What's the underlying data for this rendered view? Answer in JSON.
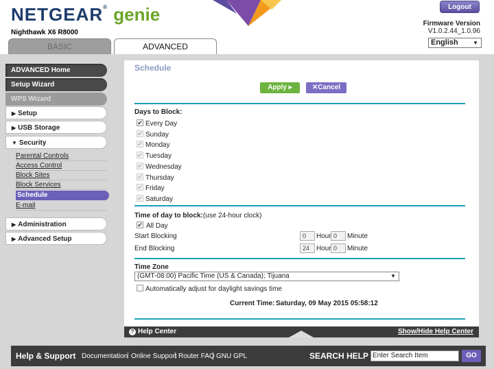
{
  "header": {
    "logo_main": "NETGEAR",
    "logo_reg": "®",
    "logo_genie": "genie",
    "model": "Nighthawk X6 R8000",
    "logout": "Logout",
    "firmware_label": "Firmware Version",
    "firmware_value": "V1.0.2.44_1.0.96",
    "language": "English"
  },
  "tabs": {
    "basic": "BASIC",
    "advanced": "ADVANCED"
  },
  "sidebar": {
    "advanced_home": "ADVANCED Home",
    "setup_wizard": "Setup Wizard",
    "wps_wizard": "WPS Wizard",
    "setup": "Setup",
    "usb_storage": "USB Storage",
    "security": "Security",
    "security_items": [
      "Parental Controls",
      "Access Control",
      "Block Sites",
      "Block Services",
      "Schedule",
      "E-mail"
    ],
    "administration": "Administration",
    "advanced_setup": "Advanced Setup"
  },
  "main": {
    "title": "Schedule",
    "apply": "Apply ▸",
    "cancel": "✕Cancel",
    "days_label": "Days to Block:",
    "days": [
      {
        "label": "Every Day",
        "checked": true
      },
      {
        "label": "Sunday",
        "checked": true
      },
      {
        "label": "Monday",
        "checked": true
      },
      {
        "label": "Tuesday",
        "checked": true
      },
      {
        "label": "Wednesday",
        "checked": true
      },
      {
        "label": "Thursday",
        "checked": true
      },
      {
        "label": "Friday",
        "checked": true
      },
      {
        "label": "Saturday",
        "checked": true
      }
    ],
    "time_label": "Time of day to block:",
    "time_hint": "(use 24-hour clock)",
    "all_day": "All Day",
    "start_label": "Start Blocking",
    "start_hour": "0",
    "start_minute": "0",
    "end_label": "End Blocking",
    "end_hour": "24",
    "end_minute": "0",
    "hour_unit": "Hour",
    "minute_unit": "Minute",
    "tz_label": "Time Zone",
    "tz_value": "(GMT-08:00) Pacific Time (US & Canada); Tijuana",
    "dst_label": "Automatically adjust for daylight savings time",
    "current_time_label": "Current Time:",
    "current_time_value": "Saturday, 09 May 2015 05:58:12"
  },
  "helpbar": {
    "help_center": "Help Center",
    "show_hide": "Show/Hide Help Center"
  },
  "footer": {
    "help_support": "Help & Support",
    "links": [
      "Documentation",
      "Online Support",
      "Router FAQ",
      "GNU GPL"
    ],
    "search_help": "SEARCH HELP",
    "search_placeholder": "Enter Search Item",
    "go": "GO"
  },
  "colors": {
    "brand_blue": "#1e3c6c",
    "genie_green": "#6ba529",
    "accent_purple": "#6b5fb8",
    "teal_rule": "#19a0b2",
    "apply_green": "#6db33f"
  }
}
